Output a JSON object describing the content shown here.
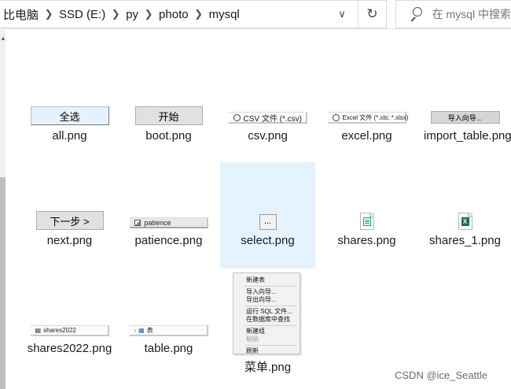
{
  "address_bar": {
    "crumbs": [
      "比电脑",
      "SSD (E:)",
      "py",
      "photo",
      "mysql"
    ],
    "search_placeholder": "在 mysql 中搜索"
  },
  "files": [
    {
      "name": "all.png",
      "thumb_text": "全选"
    },
    {
      "name": "boot.png",
      "thumb_text": "开始"
    },
    {
      "name": "csv.png",
      "thumb_text": "CSV 文件 (*.csv)"
    },
    {
      "name": "excel.png",
      "thumb_text": "Excel 文件 (*.xls; *.xlsx)"
    },
    {
      "name": "import_table.png",
      "thumb_text": "导入向导..."
    },
    {
      "name": "next.png",
      "thumb_text": "下一步 >"
    },
    {
      "name": "patience.png",
      "thumb_text": "patience"
    },
    {
      "name": "select.png",
      "thumb_text": "...",
      "selected": true
    },
    {
      "name": "shares.png",
      "thumb_text": ""
    },
    {
      "name": "shares_1.png",
      "thumb_text": "X"
    },
    {
      "name": "shares2022.png",
      "thumb_text": "shares2022"
    },
    {
      "name": "table.png",
      "thumb_text": "表"
    },
    {
      "name": "菜单.png",
      "thumb_text": ""
    }
  ],
  "context_menu_items": [
    "新建表",
    "导入向导...",
    "导出向导...",
    "运行 SQL 文件...",
    "在数据库中查找",
    "新建组",
    "粘贴",
    "刷新"
  ],
  "watermark": "CSDN @ice_Seattle",
  "colors": {
    "selection": "#e5f3ff",
    "button_face": "#e1e1e1",
    "excel_green": "#1e7145"
  }
}
